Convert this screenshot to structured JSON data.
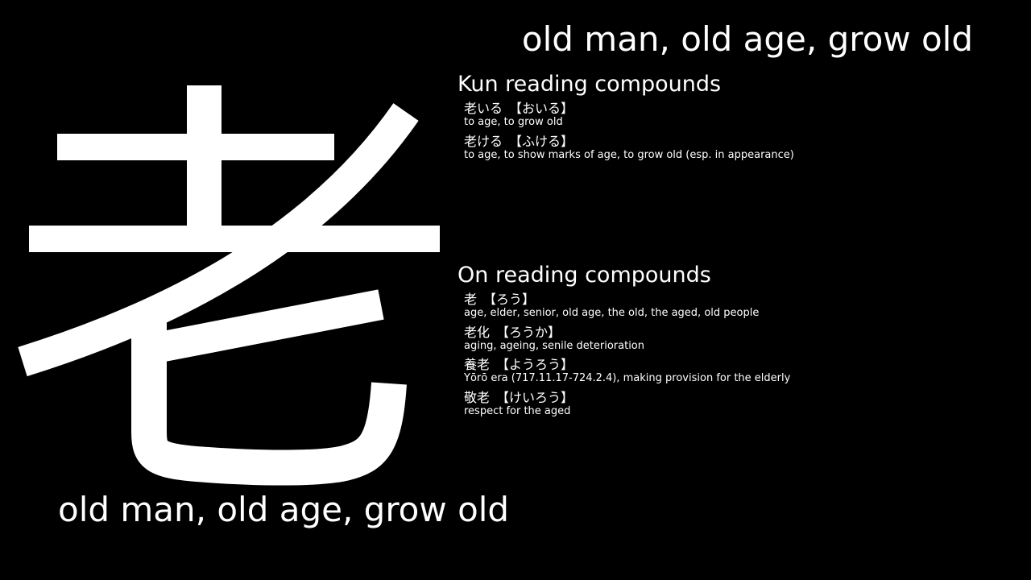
{
  "kanji": "老",
  "meaning_top": "old man, old age, grow old",
  "meaning_bottom": "old man, old age, grow old",
  "kun": {
    "heading": "Kun reading compounds",
    "items": [
      {
        "word": "老いる",
        "reading": "【おいる】",
        "gloss": "to age, to grow old"
      },
      {
        "word": "老ける",
        "reading": "【ふける】",
        "gloss": "to age, to show marks of age, to grow old (esp. in appearance)"
      }
    ]
  },
  "on": {
    "heading": "On reading compounds",
    "items": [
      {
        "word": "老",
        "reading": "【ろう】",
        "gloss": "age, elder, senior, old age, the old, the aged, old people"
      },
      {
        "word": "老化",
        "reading": "【ろうか】",
        "gloss": "aging, ageing, senile deterioration"
      },
      {
        "word": "養老",
        "reading": "【ようろう】",
        "gloss": "Yōrō era (717.11.17-724.2.4), making provision for the elderly"
      },
      {
        "word": "敬老",
        "reading": "【けいろう】",
        "gloss": "respect for the aged"
      }
    ]
  },
  "colors": {
    "background": "#000000",
    "text": "#ffffff"
  }
}
